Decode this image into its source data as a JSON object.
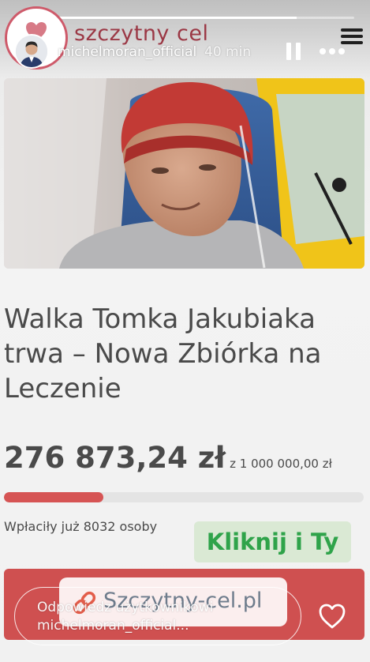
{
  "story": {
    "progress_fraction": 0.83,
    "username": "michelmoran_official",
    "time_ago": "40 min"
  },
  "site": {
    "logo_text": "szczytny cel"
  },
  "post": {
    "title": "Walka Tomka Jakubiaka trwa – Nowa Zbiórka na Leczenie",
    "amount_raised": "276 873,24 zł",
    "goal_text": "z 1 000 000,00 zł",
    "funding_fraction": 0.277,
    "donors_text": "Wpłaciły już 8032 osoby",
    "cta_sticker": "Kliknij i Ty",
    "link_sticker": "Szczytny-cel.pl"
  },
  "reply": {
    "placeholder": "Odpowiedz użytkownikowi michelmoran_official..."
  },
  "icons": {
    "menu": "hamburger-menu-icon",
    "pause": "pause-icon",
    "more": "more-dots-icon",
    "link": "link-icon",
    "like": "heart-icon",
    "logo": "heart-logo-icon"
  },
  "colors": {
    "accent_red": "#cf5050",
    "fund_bar": "#d65454",
    "cta_green": "#2fa34a",
    "logo_text": "#9b3845",
    "body_text": "#4a4a4a"
  }
}
